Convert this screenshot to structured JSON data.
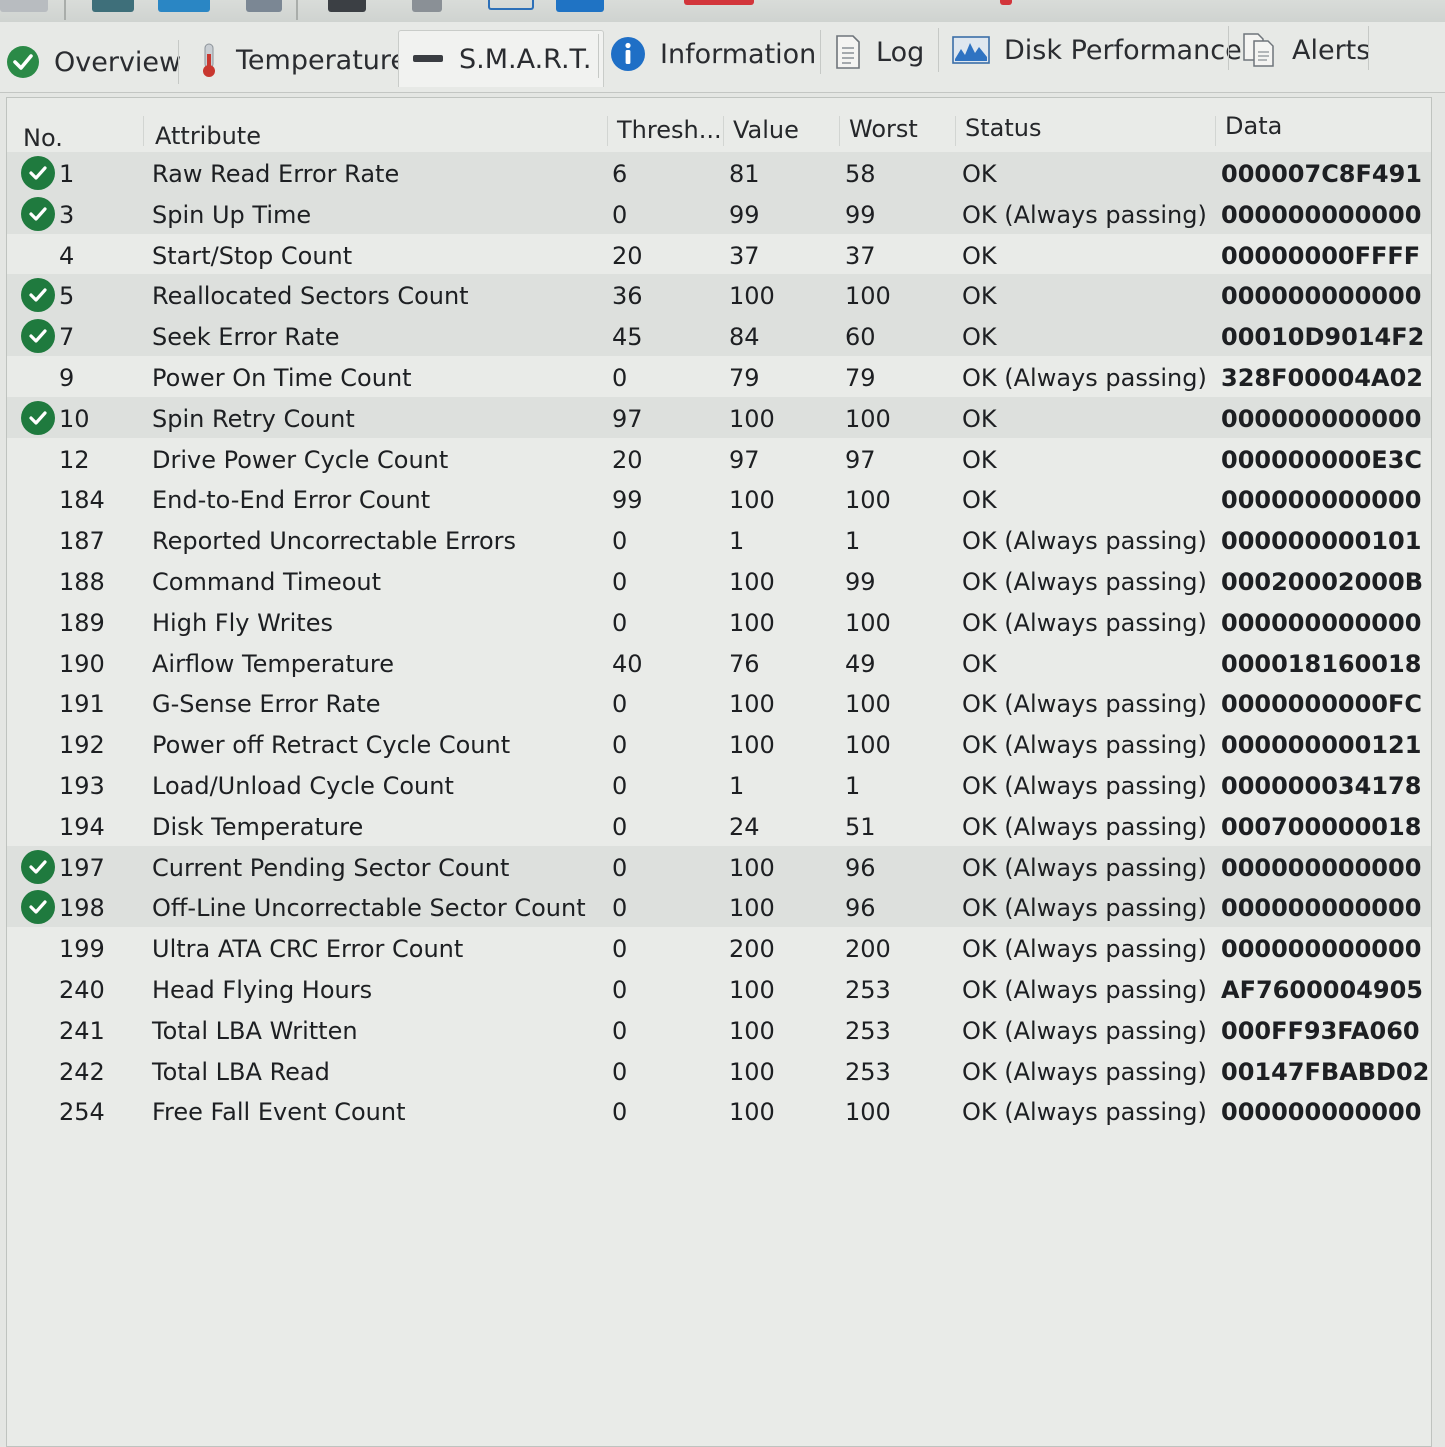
{
  "tabs": [
    {
      "label": "Overview",
      "icon": "check-circle-icon"
    },
    {
      "label": "Temperature",
      "icon": "thermometer-icon"
    },
    {
      "label": "S.M.A.R.T.",
      "icon": "dash-icon"
    },
    {
      "label": "Information",
      "icon": "info-icon"
    },
    {
      "label": "Log",
      "icon": "document-icon"
    },
    {
      "label": "Disk Performance",
      "icon": "performance-chart-icon"
    },
    {
      "label": "Alerts",
      "icon": "alerts-documents-icon"
    }
  ],
  "table": {
    "headers": {
      "no": "No.",
      "attribute": "Attribute",
      "threshold": "Thresh...",
      "value": "Value",
      "worst": "Worst",
      "status": "Status",
      "data": "Data"
    },
    "rows": [
      {
        "check": true,
        "no": "1",
        "attribute": "Raw Read Error Rate",
        "threshold": "6",
        "value": "81",
        "worst": "58",
        "status": "OK",
        "data": "000007C8F491"
      },
      {
        "check": true,
        "no": "3",
        "attribute": "Spin Up Time",
        "threshold": "0",
        "value": "99",
        "worst": "99",
        "status": "OK (Always passing)",
        "data": "000000000000"
      },
      {
        "check": false,
        "no": "4",
        "attribute": "Start/Stop Count",
        "threshold": "20",
        "value": "37",
        "worst": "37",
        "status": "OK",
        "data": "00000000FFFF"
      },
      {
        "check": true,
        "no": "5",
        "attribute": "Reallocated Sectors Count",
        "threshold": "36",
        "value": "100",
        "worst": "100",
        "status": "OK",
        "data": "000000000000"
      },
      {
        "check": true,
        "no": "7",
        "attribute": "Seek Error Rate",
        "threshold": "45",
        "value": "84",
        "worst": "60",
        "status": "OK",
        "data": "00010D9014F2"
      },
      {
        "check": false,
        "no": "9",
        "attribute": "Power On Time Count",
        "threshold": "0",
        "value": "79",
        "worst": "79",
        "status": "OK (Always passing)",
        "data": "328F00004A02"
      },
      {
        "check": true,
        "no": "10",
        "attribute": "Spin Retry Count",
        "threshold": "97",
        "value": "100",
        "worst": "100",
        "status": "OK",
        "data": "000000000000"
      },
      {
        "check": false,
        "no": "12",
        "attribute": "Drive Power Cycle Count",
        "threshold": "20",
        "value": "97",
        "worst": "97",
        "status": "OK",
        "data": "000000000E3C"
      },
      {
        "check": false,
        "no": "184",
        "attribute": "End-to-End Error Count",
        "threshold": "99",
        "value": "100",
        "worst": "100",
        "status": "OK",
        "data": "000000000000"
      },
      {
        "check": false,
        "no": "187",
        "attribute": "Reported Uncorrectable Errors",
        "threshold": "0",
        "value": "1",
        "worst": "1",
        "status": "OK (Always passing)",
        "data": "000000000101"
      },
      {
        "check": false,
        "no": "188",
        "attribute": "Command Timeout",
        "threshold": "0",
        "value": "100",
        "worst": "99",
        "status": "OK (Always passing)",
        "data": "00020002000B"
      },
      {
        "check": false,
        "no": "189",
        "attribute": "High Fly Writes",
        "threshold": "0",
        "value": "100",
        "worst": "100",
        "status": "OK (Always passing)",
        "data": "000000000000"
      },
      {
        "check": false,
        "no": "190",
        "attribute": "Airflow Temperature",
        "threshold": "40",
        "value": "76",
        "worst": "49",
        "status": "OK",
        "data": "000018160018"
      },
      {
        "check": false,
        "no": "191",
        "attribute": "G-Sense Error Rate",
        "threshold": "0",
        "value": "100",
        "worst": "100",
        "status": "OK (Always passing)",
        "data": "0000000000FC"
      },
      {
        "check": false,
        "no": "192",
        "attribute": "Power off Retract Cycle Count",
        "threshold": "0",
        "value": "100",
        "worst": "100",
        "status": "OK (Always passing)",
        "data": "000000000121"
      },
      {
        "check": false,
        "no": "193",
        "attribute": "Load/Unload Cycle Count",
        "threshold": "0",
        "value": "1",
        "worst": "1",
        "status": "OK (Always passing)",
        "data": "000000034178"
      },
      {
        "check": false,
        "no": "194",
        "attribute": "Disk Temperature",
        "threshold": "0",
        "value": "24",
        "worst": "51",
        "status": "OK (Always passing)",
        "data": "000700000018"
      },
      {
        "check": true,
        "no": "197",
        "attribute": "Current Pending Sector Count",
        "threshold": "0",
        "value": "100",
        "worst": "96",
        "status": "OK (Always passing)",
        "data": "000000000000"
      },
      {
        "check": true,
        "no": "198",
        "attribute": "Off-Line Uncorrectable Sector Count",
        "threshold": "0",
        "value": "100",
        "worst": "96",
        "status": "OK (Always passing)",
        "data": "000000000000"
      },
      {
        "check": false,
        "no": "199",
        "attribute": "Ultra ATA CRC Error Count",
        "threshold": "0",
        "value": "200",
        "worst": "200",
        "status": "OK (Always passing)",
        "data": "000000000000"
      },
      {
        "check": false,
        "no": "240",
        "attribute": "Head Flying Hours",
        "threshold": "0",
        "value": "100",
        "worst": "253",
        "status": "OK (Always passing)",
        "data": "AF7600004905"
      },
      {
        "check": false,
        "no": "241",
        "attribute": "Total LBA Written",
        "threshold": "0",
        "value": "100",
        "worst": "253",
        "status": "OK (Always passing)",
        "data": "000FF93FA060"
      },
      {
        "check": false,
        "no": "242",
        "attribute": "Total LBA Read",
        "threshold": "0",
        "value": "100",
        "worst": "253",
        "status": "OK (Always passing)",
        "data": "00147FBABD02"
      },
      {
        "check": false,
        "no": "254",
        "attribute": "Free Fall Event Count",
        "threshold": "0",
        "value": "100",
        "worst": "100",
        "status": "OK (Always passing)",
        "data": "000000000000"
      }
    ]
  },
  "colors": {
    "ok_green": "#1f7a3e",
    "info_blue": "#1f6fc6"
  }
}
